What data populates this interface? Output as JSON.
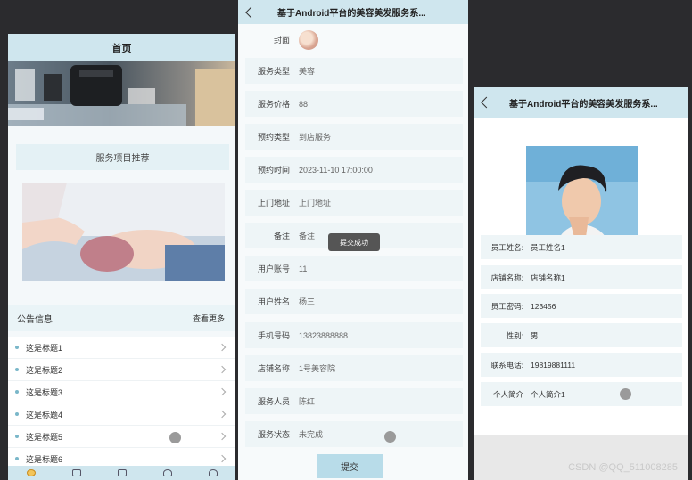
{
  "screen1": {
    "title": "首页",
    "recommend_label": "服务项目推荐",
    "notice_title": "公告信息",
    "notice_more": "查看更多",
    "notices": [
      "这是标题1",
      "这是标题2",
      "这是标题3",
      "这是标题4",
      "这是标题5",
      "这是标题6"
    ],
    "tabs": [
      "home-icon",
      "grid-icon",
      "calendar-icon",
      "message-icon",
      "user-icon"
    ]
  },
  "screen2": {
    "title": "基于Android平台的美容美发服务系...",
    "cover_label": "封面",
    "fields": [
      {
        "label": "服务类型",
        "value": "美容"
      },
      {
        "label": "服务价格",
        "value": "88"
      },
      {
        "label": "预约类型",
        "value": "到店服务"
      },
      {
        "label": "预约时间",
        "value": "2023-11-10 17:00:00"
      },
      {
        "label": "上门地址",
        "value": "上门地址"
      },
      {
        "label": "备注",
        "value": "备注"
      },
      {
        "label": "用户账号",
        "value": "11"
      },
      {
        "label": "用户姓名",
        "value": "杨三"
      },
      {
        "label": "手机号码",
        "value": "13823888888"
      },
      {
        "label": "店铺名称",
        "value": "1号美容院"
      },
      {
        "label": "服务人员",
        "value": "陈红"
      },
      {
        "label": "服务状态",
        "value": "未完成"
      }
    ],
    "toast": "提交成功",
    "submit_label": "提交"
  },
  "screen3": {
    "title": "基于Android平台的美容美发服务系...",
    "fields": [
      {
        "label": "员工姓名:",
        "value": "员工姓名1"
      },
      {
        "label": "店铺名称:",
        "value": "店铺名称1"
      },
      {
        "label": "员工密码:",
        "value": "123456"
      },
      {
        "label": "性别:",
        "value": "男"
      },
      {
        "label": "联系电话:",
        "value": "19819881111"
      },
      {
        "label": "个人简介",
        "value": "个人简介1"
      }
    ]
  },
  "watermark": "CSDN @QQ_511008285"
}
